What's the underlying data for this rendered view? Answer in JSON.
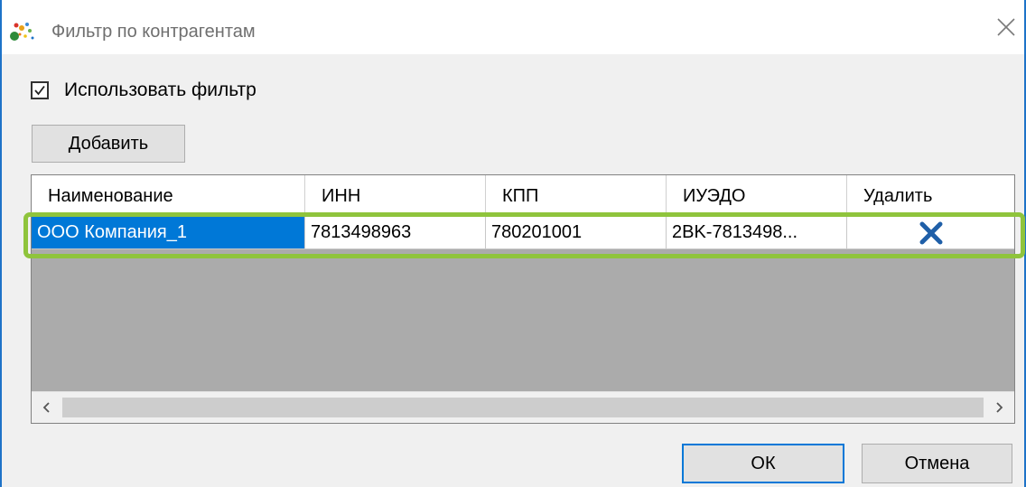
{
  "window": {
    "title": "Фильтр по контрагентам",
    "app_icon": "app-logo-icon",
    "close_icon": "close-icon"
  },
  "filter": {
    "use_filter_label": "Использовать фильтр",
    "use_filter_checked": true
  },
  "toolbar": {
    "add_label": "Добавить"
  },
  "table": {
    "columns": [
      "Наименование",
      "ИНН",
      "КПП",
      "ИУЭДО",
      "Удалить"
    ],
    "rows": [
      {
        "name": "ООО Компания_1",
        "inn": "7813498963",
        "kpp": "780201001",
        "iuedo": "2BK-7813498...",
        "delete_icon": "delete-x-icon"
      }
    ],
    "selected_row": 0
  },
  "scrollbar": {
    "left_icon": "chevron-left-icon",
    "right_icon": "chevron-right-icon"
  },
  "buttons": {
    "ok_label": "ОК",
    "cancel_label": "Отмена"
  },
  "colors": {
    "selection": "#0078d7",
    "highlight": "#8fc43c",
    "delete_icon": "#1f5fa8",
    "window_border": "#1e73c8"
  }
}
